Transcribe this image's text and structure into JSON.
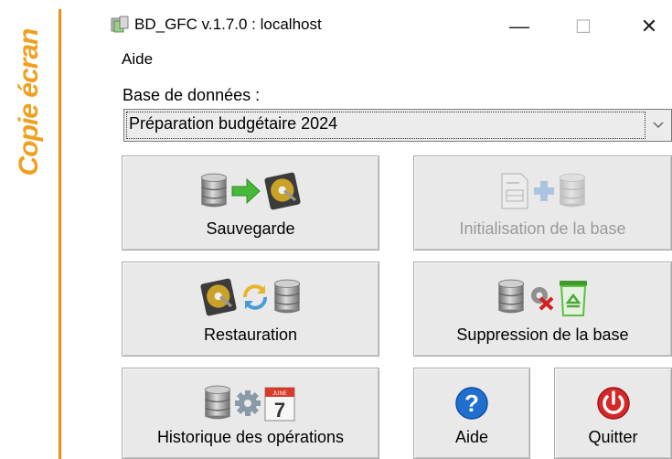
{
  "side_label": "Copie écran",
  "window": {
    "title": "BD_GFC v.1.7.0 : localhost",
    "minimize_glyph": "—",
    "maximize_glyph": "☐",
    "close_glyph": "✕"
  },
  "menu": {
    "aide": "Aide"
  },
  "database": {
    "label": "Base de données :",
    "selected": "Préparation budgétaire 2024"
  },
  "buttons": {
    "sauvegarde": "Sauvegarde",
    "initialisation": "Initialisation de la base",
    "restauration": "Restauration",
    "suppression": "Suppression de la base",
    "historique": "Historique des opérations",
    "aide": "Aide",
    "quitter": "Quitter"
  },
  "calendar": {
    "month": "JUNE",
    "day": "7"
  },
  "icons": {
    "database": "database-icon",
    "arrow": "arrow-right-icon",
    "hard_drive": "hard-drive-icon",
    "document": "document-icon",
    "plus": "plus-icon",
    "refresh": "refresh-icon",
    "gear": "gear-icon",
    "delete": "delete-x-icon",
    "recycle": "recycle-bin-icon",
    "calendar": "calendar-icon",
    "help": "help-icon",
    "power": "power-icon"
  },
  "colors": {
    "side_label": "#f0a020",
    "side_bar": "#f08a1a",
    "arrow": "#46b83a",
    "help": "#1e6fd0",
    "power": "#d62828",
    "recycle": "#5ec040"
  }
}
